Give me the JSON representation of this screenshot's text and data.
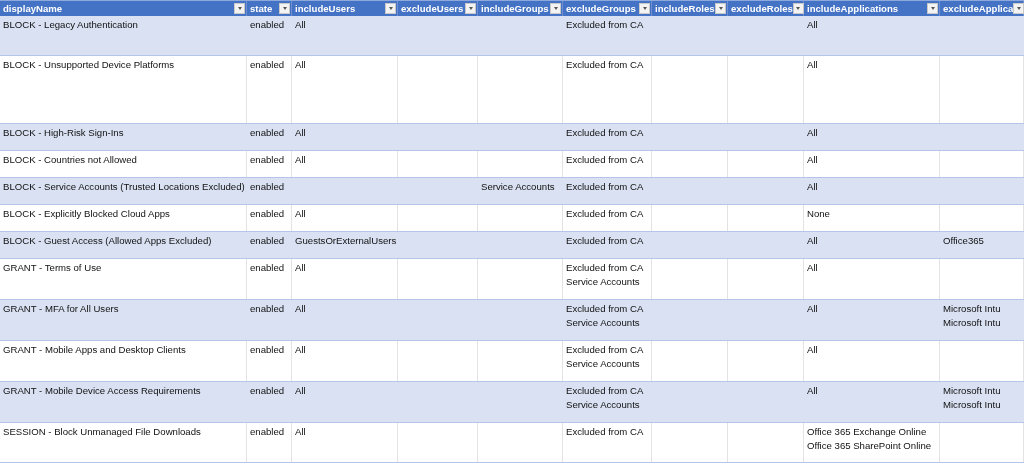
{
  "table": {
    "columns": [
      "displayName",
      "state",
      "includeUsers",
      "excludeUsers",
      "includeGroups",
      "excludeGroups",
      "includeRoles",
      "excludeRoles",
      "includeApplications",
      "excludeApplica"
    ],
    "rows": [
      {
        "cells": [
          "BLOCK - Legacy Authentication",
          "enabled",
          "All",
          null,
          null,
          "Excluded from CA",
          null,
          null,
          "All",
          null
        ]
      },
      {
        "cells": [
          "BLOCK - Unsupported Device Platforms",
          "enabled",
          "All",
          null,
          null,
          "Excluded from CA",
          null,
          null,
          "All",
          null
        ]
      },
      {
        "cells": [
          "BLOCK - High-Risk Sign-Ins",
          "enabled",
          "All",
          null,
          null,
          "Excluded from CA",
          null,
          null,
          "All",
          null
        ]
      },
      {
        "cells": [
          "BLOCK - Countries not Allowed",
          "enabled",
          "All",
          null,
          null,
          "Excluded from CA",
          null,
          null,
          "All",
          null
        ]
      },
      {
        "cells": [
          "BLOCK - Service Accounts (Trusted Locations Excluded)",
          "enabled",
          null,
          null,
          "Service Accounts",
          "Excluded from CA",
          null,
          null,
          "All",
          null
        ]
      },
      {
        "cells": [
          "BLOCK - Explicitly Blocked Cloud Apps",
          "enabled",
          "All",
          null,
          null,
          "Excluded from CA",
          null,
          null,
          "None",
          null
        ]
      },
      {
        "cells": [
          "BLOCK - Guest Access (Allowed Apps Excluded)",
          "enabled",
          "GuestsOrExternalUsers",
          null,
          null,
          "Excluded from CA",
          null,
          null,
          "All",
          "Office365"
        ]
      },
      {
        "cells": [
          "GRANT - Terms of Use",
          "enabled",
          "All",
          null,
          null,
          [
            "Excluded from CA",
            "Service Accounts"
          ],
          null,
          null,
          "All",
          null
        ]
      },
      {
        "cells": [
          "GRANT - MFA for All Users",
          "enabled",
          "All",
          null,
          null,
          [
            "Excluded from CA",
            "Service Accounts"
          ],
          null,
          null,
          "All",
          [
            "Microsoft Intu",
            "Microsoft Intu"
          ]
        ]
      },
      {
        "cells": [
          "GRANT - Mobile Apps and Desktop Clients",
          "enabled",
          "All",
          null,
          null,
          [
            "Excluded from CA",
            "Service Accounts"
          ],
          null,
          null,
          "All",
          null
        ]
      },
      {
        "cells": [
          "GRANT - Mobile Device Access Requirements",
          "enabled",
          "All",
          null,
          null,
          [
            "Excluded from CA",
            "Service Accounts"
          ],
          null,
          null,
          "All",
          [
            "Microsoft Intu",
            "Microsoft Intu"
          ]
        ]
      },
      {
        "cells": [
          "SESSION - Block Unmanaged File Downloads",
          "enabled",
          "All",
          null,
          null,
          "Excluded from CA",
          null,
          null,
          [
            "Office 365 Exchange Online",
            "Office 365 SharePoint Online"
          ],
          null
        ]
      }
    ]
  }
}
